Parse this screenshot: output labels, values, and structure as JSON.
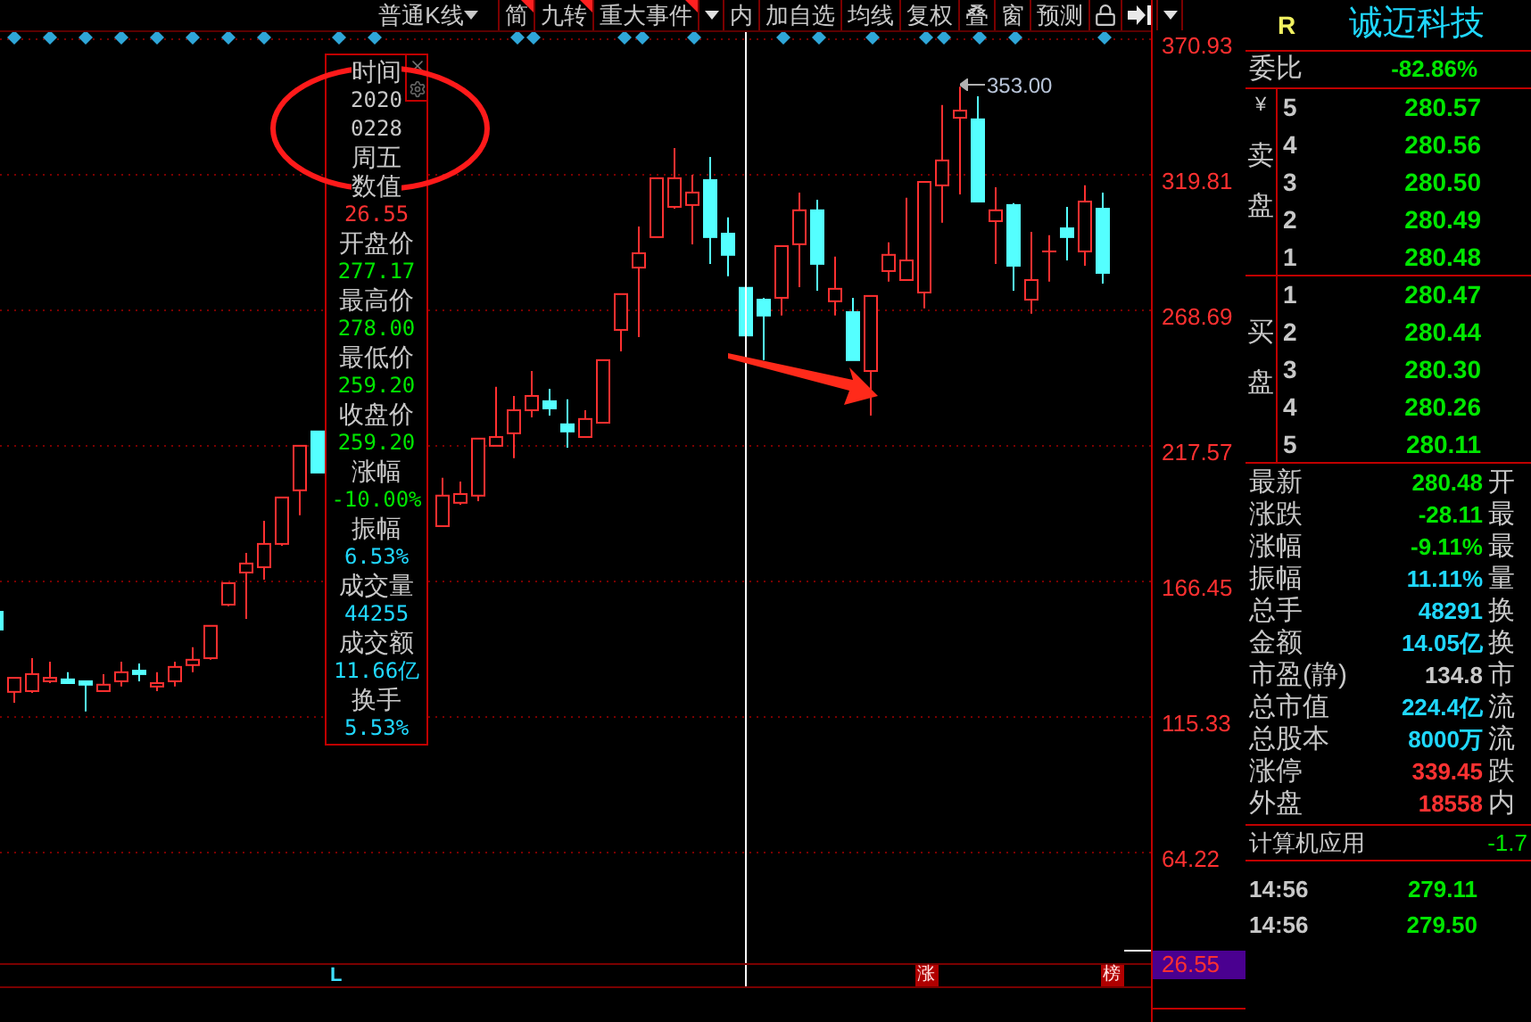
{
  "toolbar": {
    "items": [
      {
        "kind": "dropdown",
        "label": "普通K线",
        "flagged": false
      },
      {
        "kind": "button",
        "label": "简",
        "flagged": true
      },
      {
        "kind": "button",
        "label": "九转",
        "flagged": true
      },
      {
        "kind": "button",
        "label": "重大事件",
        "flagged": true
      },
      {
        "kind": "caret",
        "flagged": false
      },
      {
        "kind": "button",
        "label": "内",
        "flagged": false
      },
      {
        "kind": "button",
        "label": "加自选",
        "flagged": false
      },
      {
        "kind": "button",
        "label": "均线",
        "flagged": false
      },
      {
        "kind": "button",
        "label": "复权",
        "flagged": false
      },
      {
        "kind": "button",
        "label": "叠",
        "flagged": false
      },
      {
        "kind": "button",
        "label": "窗",
        "flagged": false
      },
      {
        "kind": "button",
        "label": "预测",
        "flagged": false
      },
      {
        "kind": "lock",
        "flagged": false
      },
      {
        "kind": "skip",
        "flagged": false
      },
      {
        "kind": "caret",
        "flagged": false
      }
    ]
  },
  "chart": {
    "chart_data": {
      "type": "candlestick",
      "ylim": [
        22.5,
        373.6
      ],
      "grid": true,
      "yticks": [
        {
          "value": 370.93,
          "label": "370.93"
        },
        {
          "value": 319.81,
          "label": "319.81"
        },
        {
          "value": 268.69,
          "label": "268.69"
        },
        {
          "value": 217.57,
          "label": "217.57"
        },
        {
          "value": 166.45,
          "label": "166.45"
        },
        {
          "value": 115.33,
          "label": "115.33"
        },
        {
          "value": 64.22,
          "label": "64.22"
        }
      ],
      "ohlc": [
        [
          155.0,
          157.1,
          146.3,
          148.3
        ],
        [
          124.8,
          130.1,
          120.7,
          130.1
        ],
        [
          125.1,
          137.5,
          124.4,
          131.5
        ],
        [
          128.8,
          136.2,
          128.1,
          130.1
        ],
        [
          129.5,
          132.2,
          128.1,
          128.1
        ],
        [
          128.8,
          128.8,
          117.4,
          127.5
        ],
        [
          125.1,
          131.5,
          125.1,
          127.5
        ],
        [
          128.8,
          136.2,
          126.8,
          132.2
        ],
        [
          132.8,
          135.5,
          128.8,
          131.5
        ],
        [
          126.8,
          132.2,
          125.1,
          128.1
        ],
        [
          128.8,
          136.2,
          126.8,
          134.2
        ],
        [
          134.9,
          141.6,
          132.2,
          136.9
        ],
        [
          137.5,
          149.7,
          136.9,
          149.7
        ],
        [
          157.7,
          165.8,
          157.1,
          165.8
        ],
        [
          169.8,
          177.2,
          152.3,
          173.2
        ],
        [
          171.8,
          189.3,
          167.1,
          180.6
        ],
        [
          180.6,
          198.1,
          179.9,
          198.1
        ],
        [
          200.8,
          217.6,
          191.4,
          217.6
        ],
        [
          223.0,
          223.0,
          207.5,
          207.5
        ],
        null,
        null,
        null,
        null,
        null,
        null,
        [
          187.3,
          205.5,
          187.3,
          198.8
        ],
        [
          196.1,
          204.1,
          195.4,
          199.4
        ],
        [
          198.8,
          220.3,
          196.7,
          220.3
        ],
        [
          217.6,
          239.8,
          217.6,
          220.9
        ],
        [
          222.3,
          236.4,
          212.9,
          231.0
        ],
        [
          231.0,
          245.8,
          228.3,
          236.4
        ],
        [
          234.4,
          239.1,
          229.0,
          231.7
        ],
        [
          225.7,
          235.1,
          216.9,
          223.0
        ],
        [
          220.9,
          231.0,
          220.9,
          227.7
        ],
        [
          226.3,
          249.9,
          226.3,
          249.9
        ],
        [
          261.3,
          274.8,
          253.2,
          274.8
        ],
        [
          284.8,
          300.3,
          258.6,
          290.2
        ],
        [
          296.3,
          318.5,
          296.3,
          318.5
        ],
        [
          307.7,
          329.9,
          307.0,
          318.5
        ],
        [
          308.4,
          319.8,
          293.6,
          313.1
        ],
        [
          317.8,
          326.5,
          286.2,
          296.3
        ],
        [
          297.6,
          303.7,
          281.5,
          289.6
        ],
        [
          277.17,
          278.0,
          259.2,
          259.2
        ],
        [
          272.7,
          273.4,
          249.9,
          266.7
        ],
        [
          273.4,
          292.9,
          266.7,
          292.9
        ],
        [
          293.6,
          313.1,
          277.4,
          306.4
        ],
        [
          306.4,
          310.4,
          276.1,
          286.2
        ],
        [
          272.1,
          288.9,
          266.7,
          276.8
        ],
        [
          268.0,
          273.4,
          249.9,
          249.9
        ],
        [
          245.8,
          274.1,
          229.0,
          274.1
        ],
        [
          283.5,
          294.3,
          279.5,
          289.6
        ],
        [
          280.1,
          311.1,
          280.1,
          287.5
        ],
        [
          275.4,
          317.1,
          269.4,
          317.1
        ],
        [
          315.8,
          346.1,
          301.7,
          325.2
        ],
        [
          341.3,
          353.0,
          312.4,
          344.0
        ],
        [
          340.7,
          349.4,
          309.7,
          309.7
        ],
        [
          302.3,
          315.1,
          286.2,
          306.4
        ],
        [
          308.4,
          309.1,
          276.1,
          285.5
        ],
        [
          272.7,
          298.3,
          267.4,
          280.1
        ],
        [
          290.9,
          297.0,
          279.5,
          290.9
        ],
        [
          299.6,
          307.7,
          287.5,
          296.3
        ],
        [
          290.9,
          315.8,
          285.5,
          309.7
        ],
        [
          307.0,
          313.1,
          278.8,
          282.8
        ]
      ]
    },
    "cursor_value": "26.55",
    "peak_label": "353.00",
    "markers": [
      {
        "kind": "plain",
        "label": "L"
      },
      {
        "kind": "boxed",
        "label": "涨"
      },
      {
        "kind": "boxed",
        "label": "榜"
      }
    ]
  },
  "tooltip": {
    "items": [
      {
        "kind": "label",
        "text": "时间"
      },
      {
        "kind": "value",
        "text": "2020",
        "color": "#c8c8c8"
      },
      {
        "kind": "value",
        "text": "0228",
        "color": "#c8c8c8"
      },
      {
        "kind": "label",
        "text": "周五"
      },
      {
        "kind": "label",
        "text": "数值"
      },
      {
        "kind": "value",
        "text": "26.55",
        "color": "#ff3232"
      },
      {
        "kind": "label",
        "text": "开盘价"
      },
      {
        "kind": "value",
        "text": "277.17",
        "color": "#00e600"
      },
      {
        "kind": "label",
        "text": "最高价"
      },
      {
        "kind": "value",
        "text": "278.00",
        "color": "#00e600"
      },
      {
        "kind": "label",
        "text": "最低价"
      },
      {
        "kind": "value",
        "text": "259.20",
        "color": "#00e600"
      },
      {
        "kind": "label",
        "text": "收盘价"
      },
      {
        "kind": "value",
        "text": "259.20",
        "color": "#00e600"
      },
      {
        "kind": "label",
        "text": "涨幅"
      },
      {
        "kind": "value",
        "text": "-10.00%",
        "color": "#00e600"
      },
      {
        "kind": "label",
        "text": "振幅"
      },
      {
        "kind": "value",
        "text": "6.53%",
        "color": "#20d8ff"
      },
      {
        "kind": "label",
        "text": "成交量"
      },
      {
        "kind": "value",
        "text": "44255",
        "color": "#20d8ff"
      },
      {
        "kind": "label",
        "text": "成交额"
      },
      {
        "kind": "value",
        "text": "11.66亿",
        "color": "#20d8ff"
      },
      {
        "kind": "label",
        "text": "换手"
      },
      {
        "kind": "value",
        "text": "5.53%",
        "color": "#20d8ff"
      }
    ]
  },
  "quote_panel": {
    "flag": "R",
    "stock_name": "诚迈科技",
    "commission_ratio": {
      "label": "委比",
      "value": "-82.86%"
    },
    "sell": {
      "currency": "¥",
      "label": "卖盘",
      "levels": [
        {
          "n": "5",
          "price": "280.57"
        },
        {
          "n": "4",
          "price": "280.56"
        },
        {
          "n": "3",
          "price": "280.50"
        },
        {
          "n": "2",
          "price": "280.49"
        },
        {
          "n": "1",
          "price": "280.48"
        }
      ]
    },
    "buy": {
      "label": "买盘",
      "levels": [
        {
          "n": "1",
          "price": "280.47"
        },
        {
          "n": "2",
          "price": "280.44"
        },
        {
          "n": "3",
          "price": "280.30"
        },
        {
          "n": "4",
          "price": "280.26"
        },
        {
          "n": "5",
          "price": "280.11"
        }
      ]
    },
    "stats": [
      {
        "label": "最新",
        "value": "280.48",
        "color": "#00e600",
        "side": "开"
      },
      {
        "label": "涨跌",
        "value": "-28.11",
        "color": "#00e600",
        "side": "最"
      },
      {
        "label": "涨幅",
        "value": "-9.11%",
        "color": "#00e600",
        "side": "最"
      },
      {
        "label": "振幅",
        "value": "11.11%",
        "color": "#20d8ff",
        "side": "量"
      },
      {
        "label": "总手",
        "value": "48291",
        "color": "#20d8ff",
        "side": "换"
      },
      {
        "label": "金额",
        "value": "14.05亿",
        "color": "#20d8ff",
        "side": "换"
      },
      {
        "label": "市盈(静)",
        "value": "134.8",
        "color": "#c8c8c8",
        "side": "市"
      },
      {
        "label": "总市值",
        "value": "224.4亿",
        "color": "#20d8ff",
        "side": "流"
      },
      {
        "label": "总股本",
        "value": "8000万",
        "color": "#20d8ff",
        "side": "流"
      },
      {
        "label": "涨停",
        "value": "339.45",
        "color": "#ff3232",
        "side": "跌"
      },
      {
        "label": "外盘",
        "value": "18558",
        "color": "#ff3232",
        "side": "内"
      }
    ],
    "sector": {
      "name": "计算机应用",
      "change": "-1.7"
    },
    "ticks": [
      {
        "time": "14:56",
        "price": "279.11"
      },
      {
        "time": "14:56",
        "price": "279.50"
      }
    ]
  }
}
